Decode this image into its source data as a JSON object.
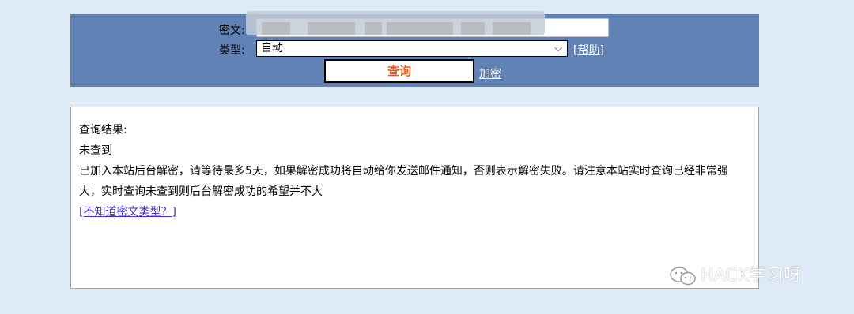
{
  "query_form": {
    "ciphertext_label": "密文:",
    "ciphertext_value": "",
    "type_label": "类型:",
    "type_selected": "自动",
    "help_link": "[帮助]",
    "query_button": "查询",
    "encrypt_link": "加密"
  },
  "result": {
    "title": "查询结果:",
    "status": "未查到",
    "detail": "已加入本站后台解密，请等待最多5天，如果解密成功将自动给你发送邮件通知，否则表示解密失败。请注意本站实时查询已经非常强大，实时查询未查到则后台解密成功的希望并不大",
    "unknown_type_link": "[不知道密文类型？]"
  },
  "watermark": {
    "text": "HACK学习呀",
    "icon": "wechat-logo"
  },
  "colors": {
    "panel_bg": "#6082b4",
    "page_bg": "#deeaf5",
    "button_text": "#f25a1c",
    "link": "#3e2ecb"
  }
}
